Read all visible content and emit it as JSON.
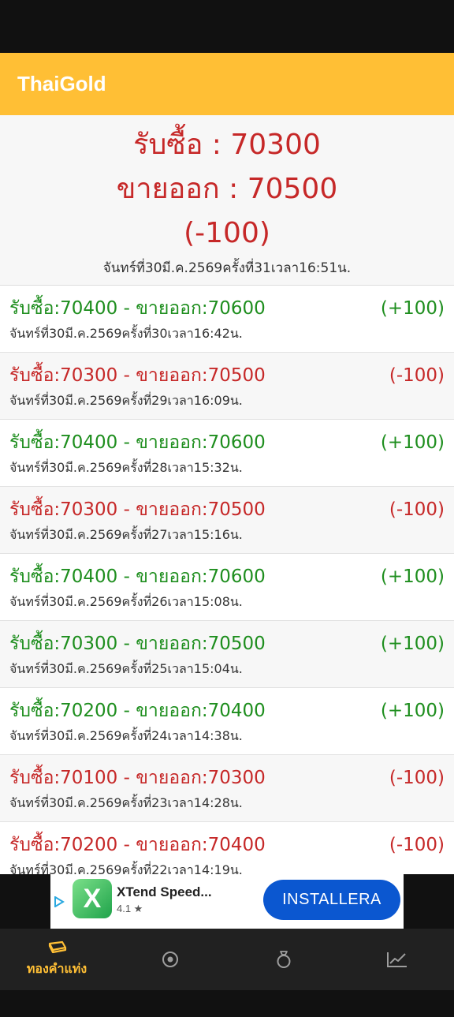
{
  "app": {
    "title": "ThaiGold"
  },
  "summary": {
    "buy": "รับซื้อ : 70300",
    "sell": "ขายออก : 70500",
    "change": "(-100)",
    "time": "จันทร์ที่30มี.ค.2569ครั้งที่31เวลา16:51น."
  },
  "rows": [
    {
      "price": "รับซื้อ:70400 - ขายออก:70600",
      "change": "(+100)",
      "time": "จันทร์ที่30มี.ค.2569ครั้งที่30เวลา16:42น."
    },
    {
      "price": "รับซื้อ:70300 - ขายออก:70500",
      "change": "(-100)",
      "time": "จันทร์ที่30มี.ค.2569ครั้งที่29เวลา16:09น."
    },
    {
      "price": "รับซื้อ:70400 - ขายออก:70600",
      "change": "(+100)",
      "time": "จันทร์ที่30มี.ค.2569ครั้งที่28เวลา15:32น."
    },
    {
      "price": "รับซื้อ:70300 - ขายออก:70500",
      "change": "(-100)",
      "time": "จันทร์ที่30มี.ค.2569ครั้งที่27เวลา15:16น."
    },
    {
      "price": "รับซื้อ:70400 - ขายออก:70600",
      "change": "(+100)",
      "time": "จันทร์ที่30มี.ค.2569ครั้งที่26เวลา15:08น."
    },
    {
      "price": "รับซื้อ:70300 - ขายออก:70500",
      "change": "(+100)",
      "time": "จันทร์ที่30มี.ค.2569ครั้งที่25เวลา15:04น."
    },
    {
      "price": "รับซื้อ:70200 - ขายออก:70400",
      "change": "(+100)",
      "time": "จันทร์ที่30มี.ค.2569ครั้งที่24เวลา14:38น."
    },
    {
      "price": "รับซื้อ:70100 - ขายออก:70300",
      "change": "(-100)",
      "time": "จันทร์ที่30มี.ค.2569ครั้งที่23เวลา14:28น."
    },
    {
      "price": "รับซื้อ:70200 - ขายออก:70400",
      "change": "(-100)",
      "time": "จันทร์ที่30มี.ค.2569ครั้งที่22เวลา14:19น."
    }
  ],
  "ad": {
    "app_name": "XTend Speed...",
    "rating": "4.1 ★",
    "install_label": "INSTALLERA",
    "icon_letter": "X"
  },
  "nav": {
    "items": [
      {
        "label": "ทองคำแท่ง",
        "icon": "gold-bar-icon",
        "active": true
      },
      {
        "label": "",
        "icon": "circle-dot-icon",
        "active": false
      },
      {
        "label": "",
        "icon": "ring-icon",
        "active": false
      },
      {
        "label": "",
        "icon": "trend-chart-icon",
        "active": false
      }
    ]
  },
  "colors": {
    "accent": "#FFBF35",
    "up": "#1E8E1E",
    "down": "#C62828",
    "nav_bg": "#212121"
  }
}
